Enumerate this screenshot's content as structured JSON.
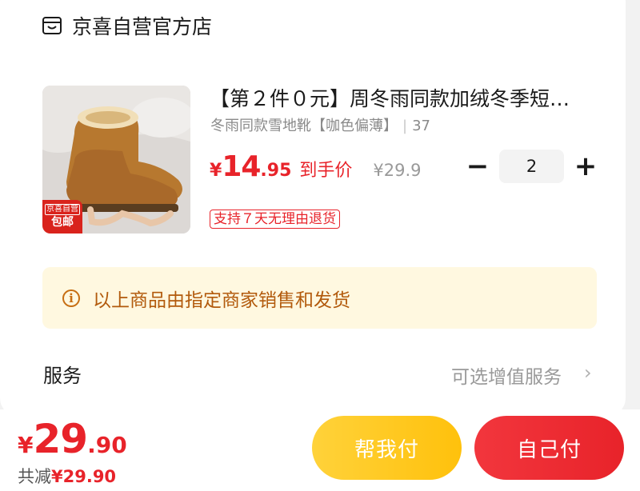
{
  "store": {
    "name": "京喜自营官方店",
    "icon": "shop-icon"
  },
  "product": {
    "title": "【第２件０元】周冬雨同款加绒冬季短…",
    "variant": "冬雨同款雪地靴【咖色偏薄】",
    "size": "37",
    "price": {
      "symbol": "¥",
      "integer": "14",
      "decimal": ".95",
      "tag": "到手价"
    },
    "original_price": "¥29.9",
    "badge": {
      "top": "京喜自营",
      "bottom": "包邮"
    },
    "quantity": {
      "minus": "−",
      "value": "2",
      "plus": "+"
    },
    "return_tag": "支持７天无理由退货"
  },
  "notice": {
    "icon": "info-icon",
    "text": "以上商品由指定商家销售和发货"
  },
  "service": {
    "label": "服务",
    "hint": "可选增值服务",
    "chevron": "›"
  },
  "footer": {
    "total": {
      "symbol": "¥",
      "integer": "29",
      "decimal": ".90"
    },
    "savings_label": "共减",
    "savings_value": "¥29.90",
    "help_pay": "帮我付",
    "self_pay": "自己付"
  },
  "colors": {
    "accent_red": "#e8232a",
    "button_yellow": "#ffc10c",
    "notice_bg": "#fff8e0"
  }
}
